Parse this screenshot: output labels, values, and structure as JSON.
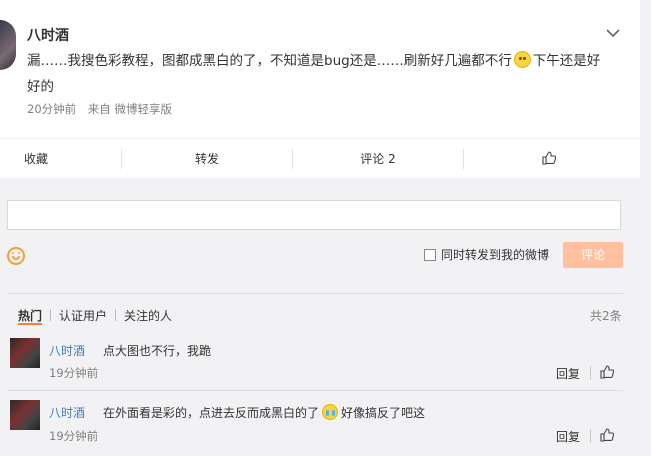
{
  "post": {
    "author": "八时酒",
    "text_part1": "漏……我搜色彩教程，图都成黑白的了，不知道是bug还是……刷新好几遍都不行",
    "text_part2": "下午还是好好的",
    "time": "20分钟前",
    "source": "来自 微博轻享版"
  },
  "actions": {
    "favorite": "收藏",
    "forward": "转发",
    "comment": "评论 2"
  },
  "composer": {
    "also_forward_label": "同时转发到我的微博",
    "submit_label": "评论"
  },
  "filters": {
    "tabs": [
      "热门",
      "认证用户",
      "关注的人"
    ],
    "count": "共2条"
  },
  "comments": [
    {
      "name": "八时酒",
      "text": "点大图也不行，我跪",
      "time": "19分钟前",
      "reply": "回复"
    },
    {
      "name": "八时酒",
      "text_part1": "在外面看是彩的，点进去反而成黑白的了",
      "text_part2": "好像搞反了吧这",
      "time": "19分钟前",
      "reply": "回复"
    }
  ],
  "colors": {
    "accent": "#fa7d3c",
    "submit_bg": "#ffc09f",
    "link": "#4a7ab5"
  }
}
